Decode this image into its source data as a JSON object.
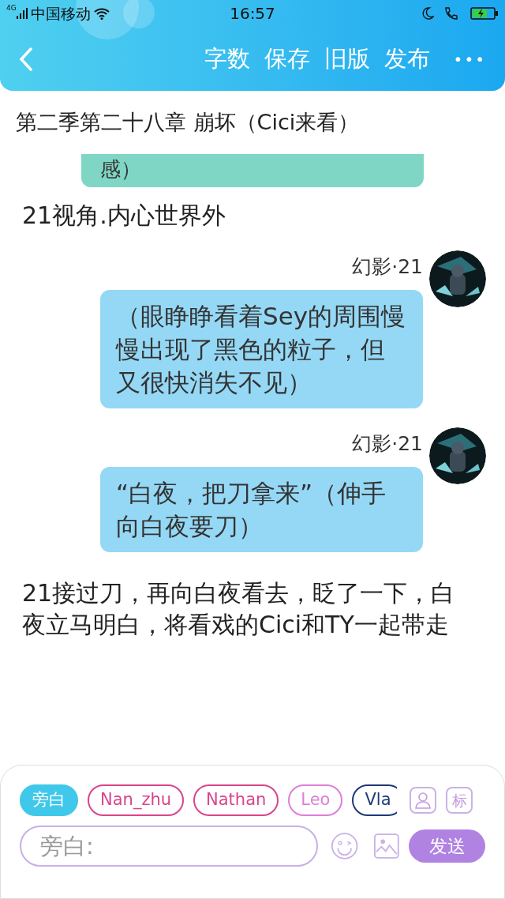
{
  "status_bar": {
    "network": "4G",
    "carrier": "中国移动",
    "time": "16:57"
  },
  "nav": {
    "actions": [
      "字数",
      "保存",
      "旧版",
      "发布"
    ],
    "more": "•••"
  },
  "chapter_title": "第二季第二十八章 崩坏（Cici来看）",
  "messages": [
    {
      "kind": "partial_bubble",
      "text": "感）",
      "color": "#7fd6c4"
    },
    {
      "kind": "narration",
      "text": "21视角.内心世界外"
    },
    {
      "kind": "bubble",
      "name": "幻影·21",
      "text": "（眼睁睁看着Sey的周围慢慢出现了黑色的粒子，但又很快消失不见）",
      "color": "#95d8f5"
    },
    {
      "kind": "bubble",
      "name": "幻影·21",
      "text": "“白夜，把刀拿来”（伸手向白夜要刀）",
      "color": "#95d8f5"
    },
    {
      "kind": "narration",
      "text": "21接过刀，再向白夜看去，眨了一下，白夜立马明白，将看戏的Cici和TY一起带走"
    }
  ],
  "roles": [
    {
      "label": "旁白",
      "selected": true,
      "color": "#3fc8ea"
    },
    {
      "label": "Nan_zhu",
      "selected": false,
      "color": "#d9458a"
    },
    {
      "label": "Nathan",
      "selected": false,
      "color": "#d9458a"
    },
    {
      "label": "Leo",
      "selected": false,
      "color": "#de7fd8"
    },
    {
      "label": "Vla",
      "selected": false,
      "color": "#1d3a78"
    }
  ],
  "tag_button": "标",
  "input": {
    "placeholder": "旁白:"
  },
  "send": "发送"
}
